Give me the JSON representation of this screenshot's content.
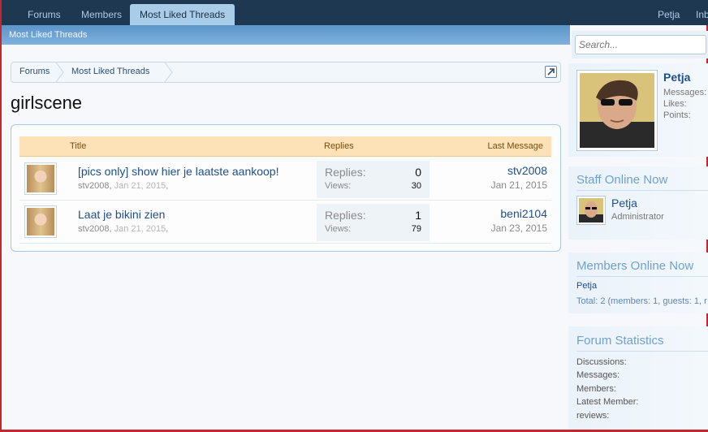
{
  "nav": {
    "tabs": [
      "Forums",
      "Members",
      "Most Liked Threads"
    ],
    "user": "Petja",
    "inbox": "Inb"
  },
  "subnav": {
    "label": "Most Liked Threads"
  },
  "search": {
    "placeholder": "Search..."
  },
  "breadcrumb": [
    "Forums",
    "Most Liked Threads"
  ],
  "page": {
    "title": "girlscene"
  },
  "table": {
    "headers": {
      "title": "Title",
      "replies": "Replies",
      "last": "Last Message"
    },
    "rows": [
      {
        "title": "[pics only] show hier je laatste aankoop!",
        "author": "stv2008",
        "date": "Jan 21, 2015",
        "replies_label": "Replies:",
        "replies": "0",
        "views_label": "Views:",
        "views": "30",
        "last_user": "stv2008",
        "last_date": "Jan 21, 2015"
      },
      {
        "title": "Laat je bikini zien",
        "author": "stv2008",
        "date": "Jan 21, 2015",
        "replies_label": "Replies:",
        "replies": "1",
        "views_label": "Views:",
        "views": "79",
        "last_user": "beni2104",
        "last_date": "Jan 23, 2015"
      }
    ]
  },
  "sidebar": {
    "profile": {
      "name": "Petja",
      "messages_label": "Messages:",
      "likes_label": "Likes:",
      "points_label": "Points:"
    },
    "staff": {
      "title": "Staff Online Now",
      "name": "Petja",
      "role": "Administrator"
    },
    "members_online": {
      "title": "Members Online Now",
      "member": "Petja",
      "total": "Total: 2 (members: 1, guests: 1, r"
    },
    "stats": {
      "title": "Forum Statistics",
      "discussions": "Discussions:",
      "messages": "Messages:",
      "members": "Members:",
      "latest": "Latest Member:",
      "reviews": "reviews:"
    }
  },
  "colors": {
    "accent": "#1e4f8a",
    "header_bg": "#1f3852",
    "table_head": "#fde2b8",
    "frame": "#c5272f"
  }
}
